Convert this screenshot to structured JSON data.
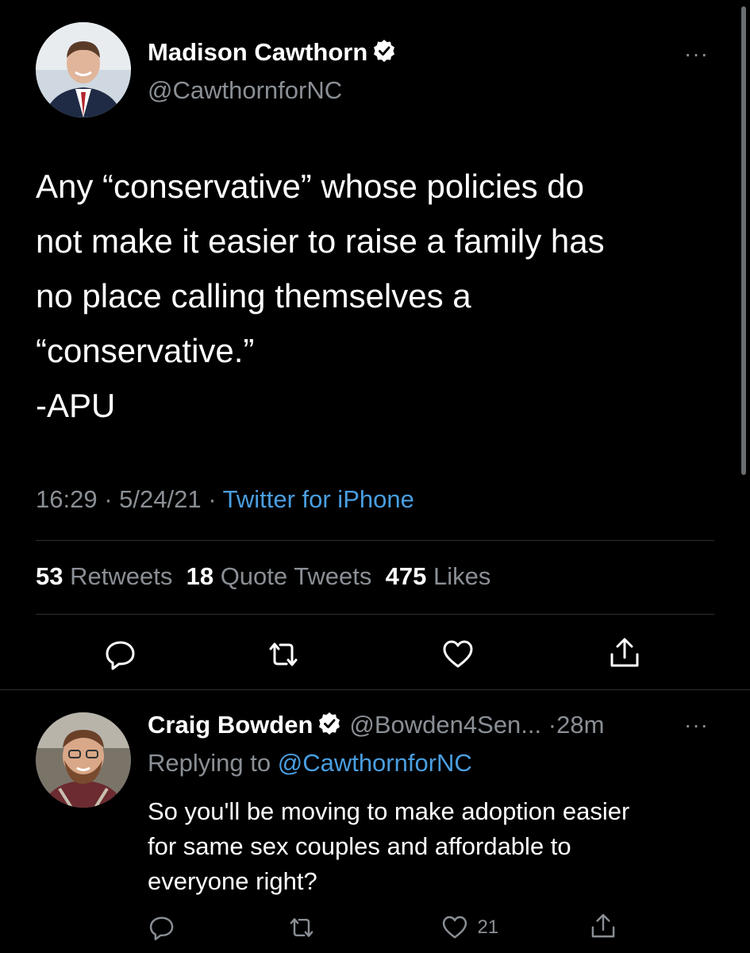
{
  "main_tweet": {
    "author_name": "Madison Cawthorn",
    "author_handle": "@CawthornforNC",
    "more_label": "···",
    "text_lines": [
      "Any “conservative” whose policies do",
      "not make it easier to raise a family has",
      "no place calling themselves a",
      "“conservative.”",
      "-APU"
    ],
    "time": "16:29",
    "date": "5/24/21",
    "separator": "·",
    "source": "Twitter for iPhone",
    "stats": [
      {
        "count": "53",
        "label": "Retweets"
      },
      {
        "count": "18",
        "label": "Quote Tweets"
      },
      {
        "count": "475",
        "label": "Likes"
      }
    ],
    "actions": [
      "reply-icon",
      "retweet-icon",
      "like-icon",
      "share-icon"
    ]
  },
  "reply_tweet": {
    "author_name": "Craig Bowden",
    "author_handle": "@Bowden4Sen...",
    "time_ago": "·28m",
    "more_label": "···",
    "replying_prefix": "Replying to",
    "replying_to": "@CawthornforNC",
    "text_lines": [
      "So you'll be moving to make adoption easier",
      "for same sex couples and affordable to",
      "everyone right?"
    ],
    "like_count": "21"
  },
  "colors": {
    "background": "#000000",
    "text": "#ffffff",
    "secondary": "#8a8f95",
    "link": "#4a9ee0",
    "divider": "#2c2f33"
  }
}
